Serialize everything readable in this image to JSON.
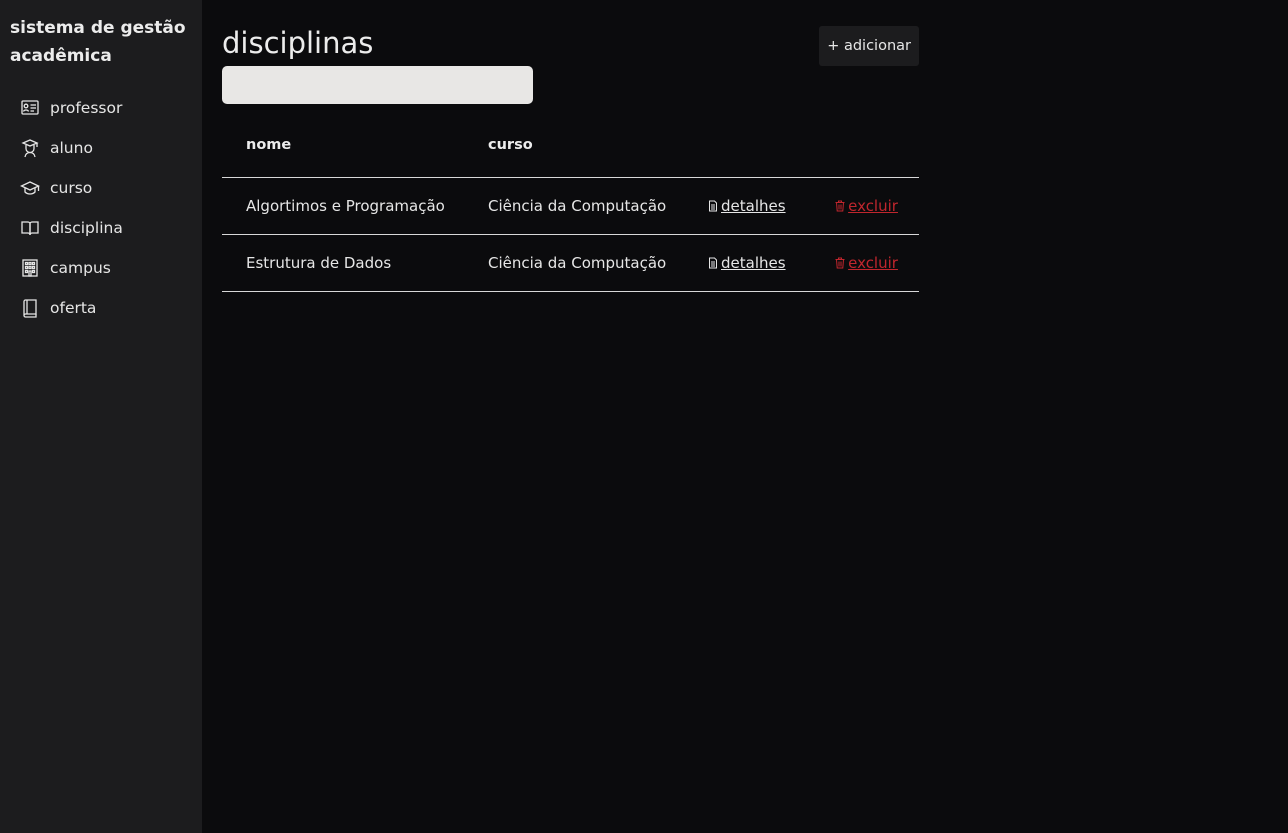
{
  "sidebar": {
    "title": "sistema de gestão acadêmica",
    "items": [
      {
        "label": "professor",
        "icon": "professor-board-icon"
      },
      {
        "label": "aluno",
        "icon": "student-icon"
      },
      {
        "label": "curso",
        "icon": "graduation-cap-icon"
      },
      {
        "label": "disciplina",
        "icon": "open-book-icon"
      },
      {
        "label": "campus",
        "icon": "building-icon"
      },
      {
        "label": "oferta",
        "icon": "book-icon"
      }
    ]
  },
  "main": {
    "title": "disciplinas",
    "add_label": "+ adicionar",
    "search": {
      "value": "",
      "placeholder": ""
    },
    "table": {
      "headers": [
        "nome",
        "curso",
        "",
        ""
      ],
      "rows": [
        {
          "nome": "Algortimos e Programação",
          "curso": "Ciência da Computação",
          "details_label": "detalhes",
          "delete_label": "excluir"
        },
        {
          "nome": "Estrutura de Dados",
          "curso": "Ciência da Computação",
          "details_label": "detalhes",
          "delete_label": "excluir"
        }
      ]
    }
  },
  "colors": {
    "background": "#0b0b0d",
    "sidebar": "#1c1c1e",
    "delete_link": "#c0262d",
    "search_bg": "#e8e7e5"
  }
}
